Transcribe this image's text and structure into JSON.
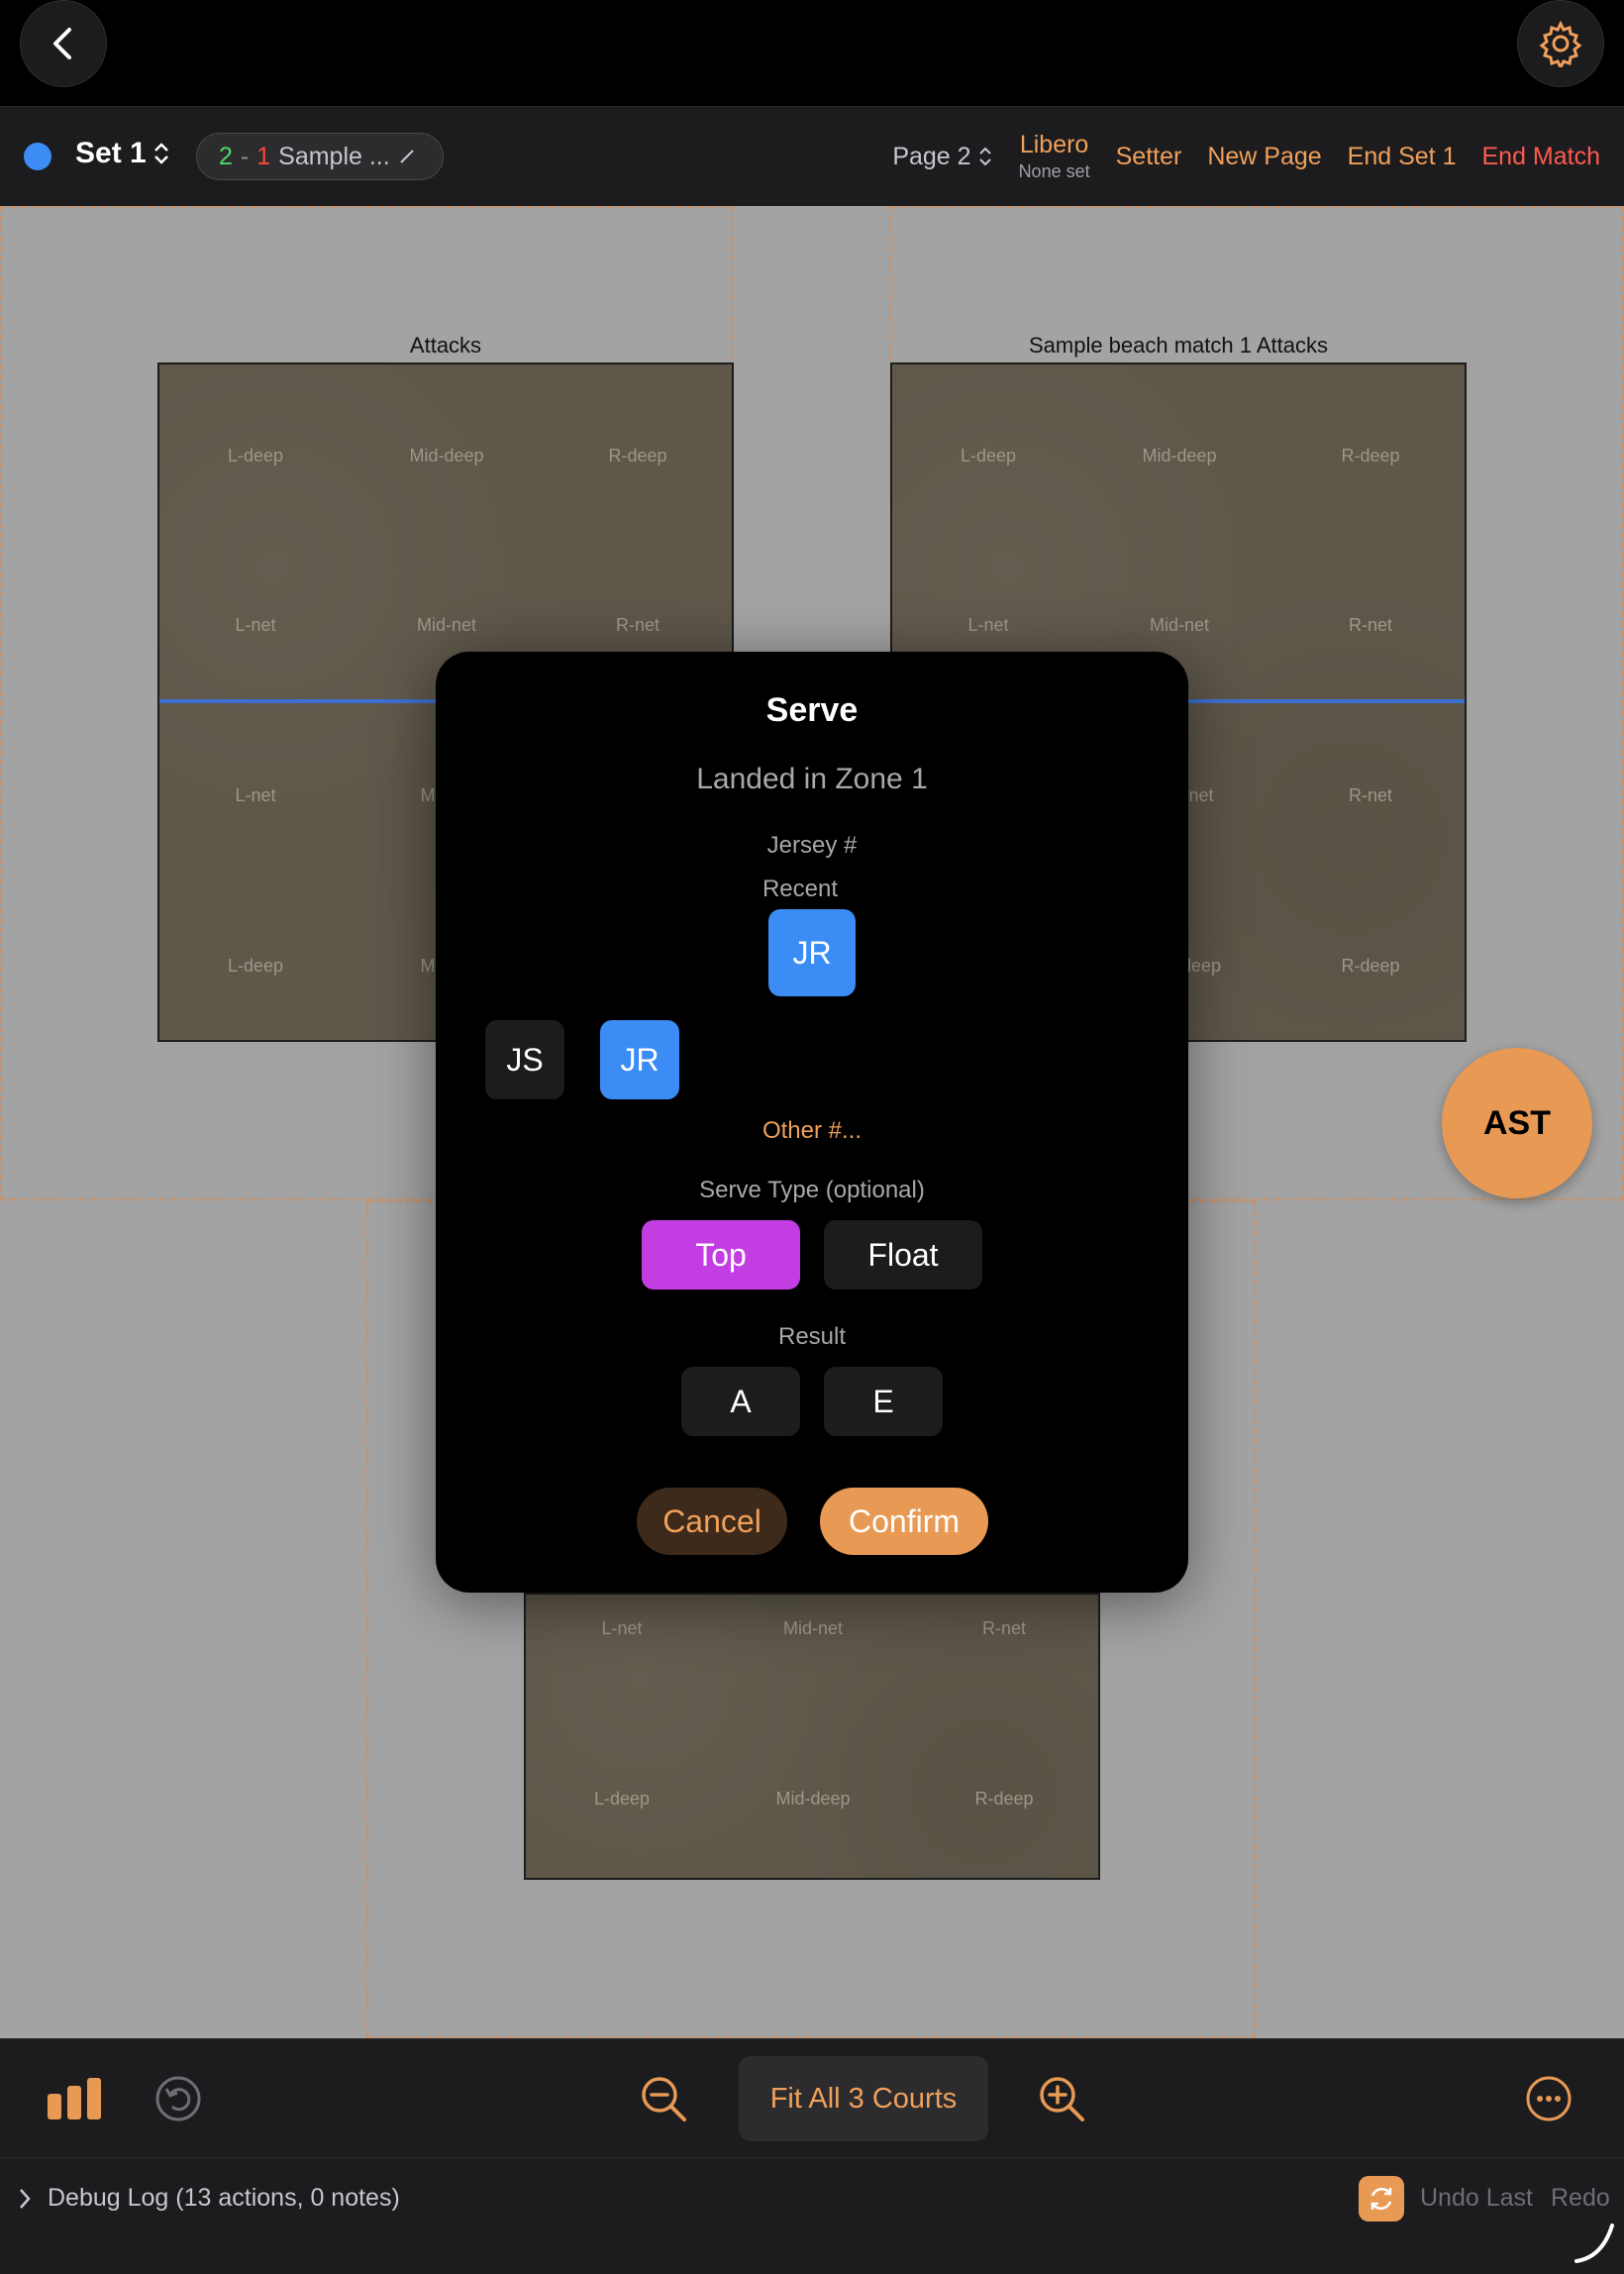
{
  "header": {
    "back_icon": "chevron-left-icon",
    "settings_icon": "gear-icon"
  },
  "setbar": {
    "set_label": "Set 1",
    "score_home": "2",
    "score_separator": "-",
    "score_away": "1",
    "match_name": "Sample ...",
    "page_label": "Page 2",
    "libero_label": "Libero",
    "libero_value": "None set",
    "setter_label": "Setter",
    "new_page_label": "New Page",
    "end_set_label": "End Set 1",
    "end_match_label": "End Match",
    "colors": {
      "accent": "#f0a05a",
      "danger": "#ff5a4e",
      "set_dot": "#3b8cf5"
    }
  },
  "courts": {
    "left_title": "Attacks",
    "right_title": "Sample beach match 1 Attacks",
    "zones": {
      "l_deep": "L-deep",
      "mid_deep": "Mid-deep",
      "r_deep": "R-deep",
      "l_net": "L-net",
      "mid_net": "Mid-net",
      "r_net": "R-net",
      "mid_partial": "Mid",
      "net_partial": "net",
      "deep_partial": "deep"
    }
  },
  "ast_button": {
    "label": "AST"
  },
  "modal": {
    "title": "Serve",
    "subtitle": "Landed in Zone 1",
    "jersey_label": "Jersey #",
    "recent_label": "Recent",
    "recent_jersey": "JR",
    "jerseys": [
      "JS",
      "JR"
    ],
    "other_link": "Other #...",
    "serve_type_label": "Serve Type (optional)",
    "serve_types": [
      "Top",
      "Float"
    ],
    "selected_serve_type": "Top",
    "result_label": "Result",
    "results": [
      "A",
      "E"
    ],
    "cancel_label": "Cancel",
    "confirm_label": "Confirm"
  },
  "toolbar": {
    "stats_icon": "bar-chart-icon",
    "undo_icon": "undo-circle-icon",
    "zoom_out_icon": "zoom-out-icon",
    "fit_label": "Fit All 3 Courts",
    "zoom_in_icon": "zoom-in-icon",
    "more_icon": "ellipsis-circle-icon"
  },
  "debug": {
    "label": "Debug Log (13 actions, 0 notes)",
    "undo_last_label": "Undo Last",
    "redo_label": "Redo"
  }
}
